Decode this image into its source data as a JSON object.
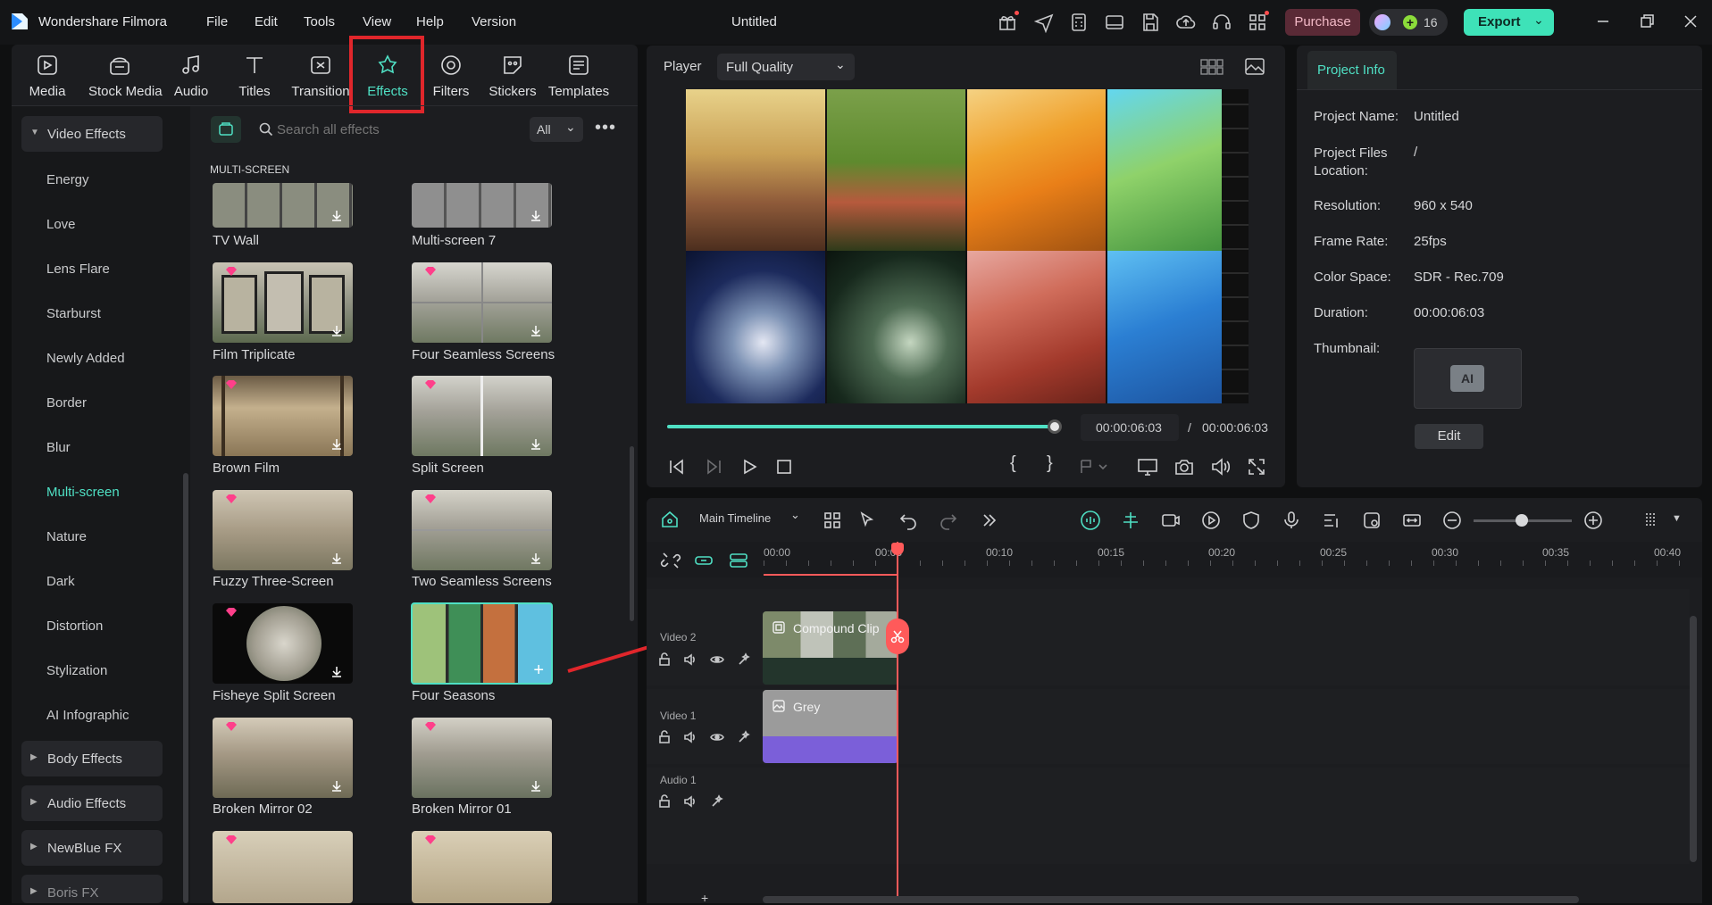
{
  "app": {
    "name": "Wondershare Filmora",
    "title": "Untitled"
  },
  "menu": [
    "File",
    "Edit",
    "Tools",
    "View",
    "Help",
    "Version"
  ],
  "header": {
    "purchase_label": "Purchase",
    "credits": "16",
    "export_label": "Export"
  },
  "tabs": [
    {
      "label": "Media",
      "icon": "media-icon"
    },
    {
      "label": "Stock Media",
      "icon": "stock-media-icon"
    },
    {
      "label": "Audio",
      "icon": "audio-icon"
    },
    {
      "label": "Titles",
      "icon": "titles-icon"
    },
    {
      "label": "Transition",
      "icon": "transition-icon"
    },
    {
      "label": "Effects",
      "icon": "effects-icon",
      "active": true
    },
    {
      "label": "Filters",
      "icon": "filters-icon"
    },
    {
      "label": "Stickers",
      "icon": "stickers-icon"
    },
    {
      "label": "Templates",
      "icon": "templates-icon"
    }
  ],
  "sidebar": {
    "video_effects": "Video Effects",
    "items": [
      "Energy",
      "Love",
      "Lens Flare",
      "Starburst",
      "Newly Added",
      "Border",
      "Blur",
      "Multi-screen",
      "Nature",
      "Dark",
      "Distortion",
      "Stylization",
      "AI Infographic"
    ],
    "selected": "Multi-screen",
    "groups": [
      "Body Effects",
      "Audio Effects",
      "NewBlue FX",
      "Boris FX"
    ]
  },
  "search": {
    "placeholder": "Search all effects",
    "filter": "All"
  },
  "section_title": "MULTI-SCREEN",
  "effects": [
    "TV Wall",
    "Multi-screen 7",
    "Film Triplicate",
    "Four Seamless Screens",
    "Brown Film",
    "Split Screen",
    "Fuzzy Three-Screen",
    "Two Seamless Screens",
    "Fisheye Split Screen",
    "Four Seasons",
    "Broken Mirror 02",
    "Broken Mirror 01"
  ],
  "player": {
    "label": "Player",
    "quality": "Full Quality",
    "current_time": "00:00:06:03",
    "separator": "/",
    "total_time": "00:00:06:03",
    "progress_fraction": 1.0
  },
  "project_info": {
    "tab": "Project Info",
    "rows": [
      {
        "label": "Project Name:",
        "value": "Untitled"
      },
      {
        "label": "Project Files Location:",
        "value": "/"
      },
      {
        "label": "Resolution:",
        "value": "960 x 540"
      },
      {
        "label": "Frame Rate:",
        "value": "25fps"
      },
      {
        "label": "Color Space:",
        "value": "SDR - Rec.709"
      },
      {
        "label": "Duration:",
        "value": "00:00:06:03"
      },
      {
        "label": "Thumbnail:",
        "value": ""
      }
    ],
    "edit_label": "Edit"
  },
  "timeline": {
    "name": "Main Timeline",
    "ticks": [
      "00:00",
      "00:05",
      "00:10",
      "00:15",
      "00:20",
      "00:25",
      "00:30",
      "00:35",
      "00:40"
    ],
    "tracks": [
      "Video 2",
      "Video 1",
      "Audio 1"
    ],
    "clip_compound": "Compound Clip",
    "clip_grey": "Grey"
  },
  "colors": {
    "accent": "#4fe0c4",
    "active_tab_highlight": "#e0262b",
    "playhead": "#ff5a5a",
    "arrow": "#e0262b",
    "export_bg": "#3ee2b8",
    "purchase_bg": "#5a2a36"
  }
}
